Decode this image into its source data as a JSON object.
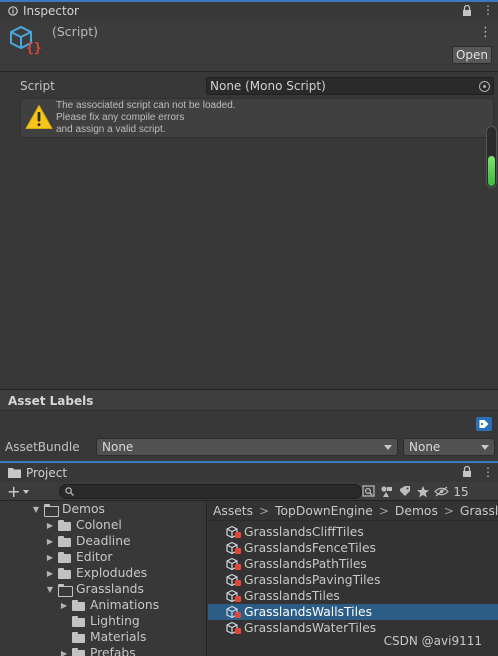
{
  "inspector": {
    "tab_label": "Inspector",
    "script_title": "(Script)",
    "open_label": "Open",
    "script_label": "Script",
    "script_value": "None (Mono Script)",
    "warning_text": "The associated script can not be loaded.\nPlease fix any compile errors\nand assign a valid script."
  },
  "asset_labels": {
    "title": "Asset Labels",
    "bundle_label": "AssetBundle",
    "bundle_value": "None",
    "variant_value": "None"
  },
  "project": {
    "tab_label": "Project",
    "add_label": "+",
    "hidden_count": "15",
    "tree": [
      {
        "label": "Demos",
        "expanded": true,
        "depth": 3
      },
      {
        "label": "Colonel",
        "expanded": false,
        "depth": 4
      },
      {
        "label": "Deadline",
        "expanded": false,
        "depth": 4
      },
      {
        "label": "Editor",
        "expanded": false,
        "depth": 4
      },
      {
        "label": "Explodudes",
        "expanded": false,
        "depth": 4
      },
      {
        "label": "Grasslands",
        "expanded": true,
        "depth": 4
      },
      {
        "label": "Animations",
        "expanded": false,
        "depth": 5
      },
      {
        "label": "Lighting",
        "expanded": null,
        "depth": 5
      },
      {
        "label": "Materials",
        "expanded": null,
        "depth": 5
      },
      {
        "label": "Prefabs",
        "expanded": false,
        "depth": 5
      }
    ],
    "breadcrumb": [
      "Assets",
      "TopDownEngine",
      "Demos",
      "Grasslands"
    ],
    "files": [
      {
        "label": "GrasslandsCliffTiles",
        "selected": false
      },
      {
        "label": "GrasslandsFenceTiles",
        "selected": false
      },
      {
        "label": "GrasslandsPathTiles",
        "selected": false
      },
      {
        "label": "GrasslandsPavingTiles",
        "selected": false
      },
      {
        "label": "GrasslandsTiles",
        "selected": false
      },
      {
        "label": "GrasslandsWallsTiles",
        "selected": true
      },
      {
        "label": "GrasslandsWaterTiles",
        "selected": false
      }
    ]
  },
  "watermark": "CSDN @avi9111",
  "colors": {
    "accent": "#3a79bb",
    "selection": "#2c5d87",
    "warning": "#f5c518",
    "script_icon_blue": "#4aa8e0",
    "script_icon_red": "#e0483a",
    "scroll_green": "#4fd04a"
  },
  "icons": {
    "tab": "info-icon",
    "lock": "lock-icon",
    "menu": "kebab-menu-icon",
    "warning": "warning-icon",
    "picker": "object-picker-icon",
    "tag": "tag-icon",
    "folder": "folder-icon",
    "file": "scriptable-object-icon",
    "search": "search-icon"
  }
}
